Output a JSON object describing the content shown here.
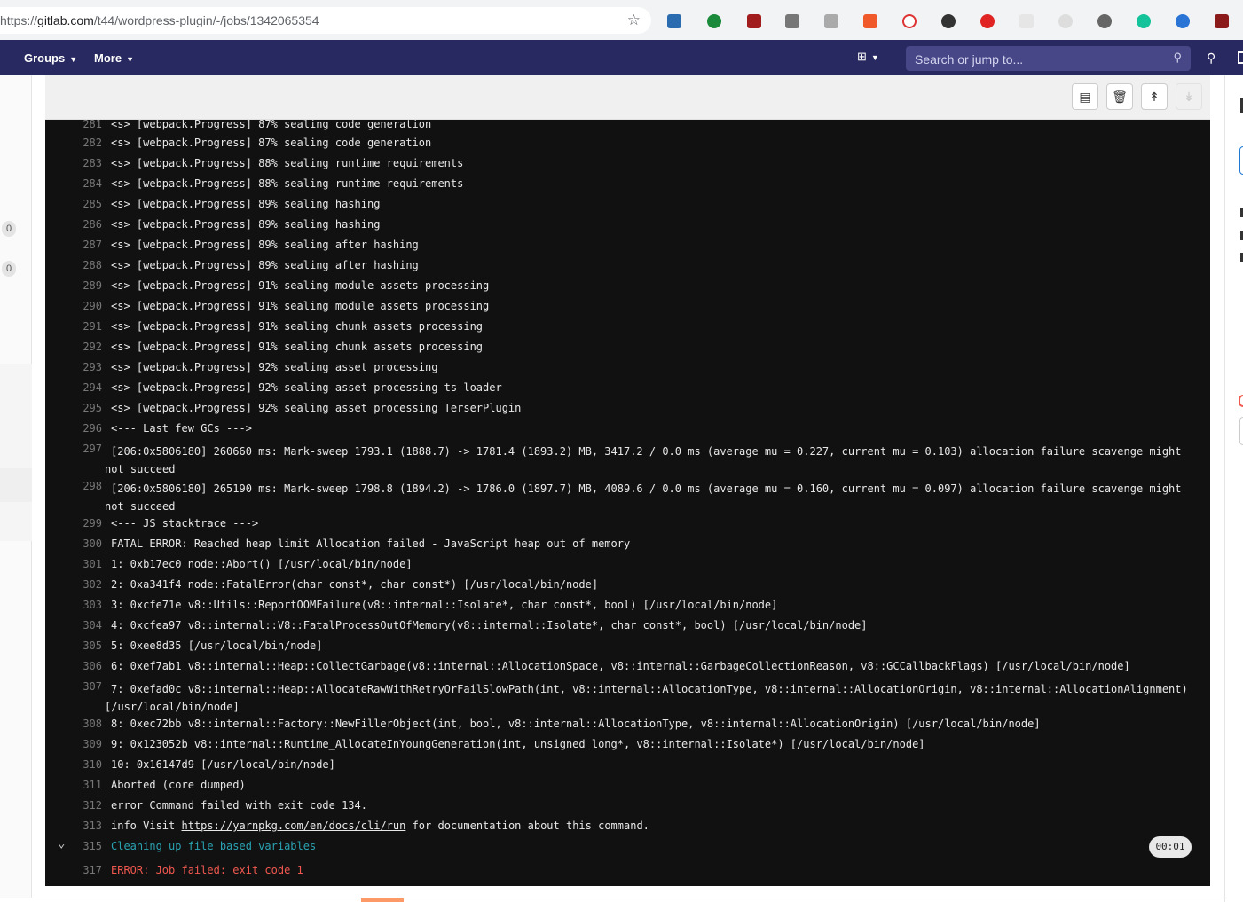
{
  "browser": {
    "url_prefix": "https://",
    "url_host": "gitlab.com",
    "url_path": "/t44/wordpress-plugin/-/jobs/1342065354"
  },
  "nav": {
    "groups_label": "Groups",
    "more_label": "More",
    "search_placeholder": "Search or jump to..."
  },
  "sidebar": {
    "badge_1": "0",
    "badge_2": "0"
  },
  "log": {
    "lines": [
      {
        "n": "281",
        "t": "<s> [webpack.Progress] 87% sealing code generation"
      },
      {
        "n": "282",
        "t": "<s> [webpack.Progress] 87% sealing code generation"
      },
      {
        "n": "283",
        "t": "<s> [webpack.Progress] 88% sealing runtime requirements"
      },
      {
        "n": "284",
        "t": "<s> [webpack.Progress] 88% sealing runtime requirements"
      },
      {
        "n": "285",
        "t": "<s> [webpack.Progress] 89% sealing hashing"
      },
      {
        "n": "286",
        "t": "<s> [webpack.Progress] 89% sealing hashing"
      },
      {
        "n": "287",
        "t": "<s> [webpack.Progress] 89% sealing after hashing"
      },
      {
        "n": "288",
        "t": "<s> [webpack.Progress] 89% sealing after hashing"
      },
      {
        "n": "289",
        "t": "<s> [webpack.Progress] 91% sealing module assets processing"
      },
      {
        "n": "290",
        "t": "<s> [webpack.Progress] 91% sealing module assets processing"
      },
      {
        "n": "291",
        "t": "<s> [webpack.Progress] 91% sealing chunk assets processing"
      },
      {
        "n": "292",
        "t": "<s> [webpack.Progress] 91% sealing chunk assets processing"
      },
      {
        "n": "293",
        "t": "<s> [webpack.Progress] 92% sealing asset processing"
      },
      {
        "n": "294",
        "t": "<s> [webpack.Progress] 92% sealing asset processing ts-loader"
      },
      {
        "n": "295",
        "t": "<s> [webpack.Progress] 92% sealing asset processing TerserPlugin"
      },
      {
        "n": "296",
        "t": "<--- Last few GCs --->"
      },
      {
        "n": "297",
        "t": "[206:0x5806180]   260660 ms: Mark-sweep 1793.1 (1888.7) -> 1781.4 (1893.2) MB, 3417.2 / 0.0 ms  (average mu = 0.227, current mu = 0.103) allocation failure scavenge might not succeed"
      },
      {
        "n": "298",
        "t": "[206:0x5806180]   265190 ms: Mark-sweep 1798.8 (1894.2) -> 1786.0 (1897.7) MB, 4089.6 / 0.0 ms  (average mu = 0.160, current mu = 0.097) allocation failure scavenge might not succeed"
      },
      {
        "n": "299",
        "t": "<--- JS stacktrace --->"
      },
      {
        "n": "300",
        "t": "FATAL ERROR: Reached heap limit Allocation failed - JavaScript heap out of memory"
      },
      {
        "n": "301",
        "t": " 1: 0xb17ec0 node::Abort() [/usr/local/bin/node]"
      },
      {
        "n": "302",
        "t": " 2: 0xa341f4 node::FatalError(char const*, char const*) [/usr/local/bin/node]"
      },
      {
        "n": "303",
        "t": " 3: 0xcfe71e v8::Utils::ReportOOMFailure(v8::internal::Isolate*, char const*, bool) [/usr/local/bin/node]"
      },
      {
        "n": "304",
        "t": " 4: 0xcfea97 v8::internal::V8::FatalProcessOutOfMemory(v8::internal::Isolate*, char const*, bool) [/usr/local/bin/node]"
      },
      {
        "n": "305",
        "t": " 5: 0xee8d35  [/usr/local/bin/node]"
      },
      {
        "n": "306",
        "t": " 6: 0xef7ab1 v8::internal::Heap::CollectGarbage(v8::internal::AllocationSpace, v8::internal::GarbageCollectionReason, v8::GCCallbackFlags) [/usr/local/bin/node]"
      },
      {
        "n": "307",
        "t": " 7: 0xefad0c v8::internal::Heap::AllocateRawWithRetryOrFailSlowPath(int, v8::internal::AllocationType, v8::internal::AllocationOrigin, v8::internal::AllocationAlignment) [/usr/local/bin/node]"
      },
      {
        "n": "308",
        "t": " 8: 0xec72bb v8::internal::Factory::NewFillerObject(int, bool, v8::internal::AllocationType, v8::internal::AllocationOrigin) [/usr/local/bin/node]"
      },
      {
        "n": "309",
        "t": " 9: 0x123052b v8::internal::Runtime_AllocateInYoungGeneration(int, unsigned long*, v8::internal::Isolate*) [/usr/local/bin/node]"
      },
      {
        "n": "310",
        "t": "10: 0x16147d9  [/usr/local/bin/node]"
      },
      {
        "n": "311",
        "t": "Aborted (core dumped)"
      },
      {
        "n": "312",
        "t": "error Command failed with exit code 134."
      }
    ],
    "info_line": {
      "n": "313",
      "prefix": "info Visit ",
      "link": "https://yarnpkg.com/en/docs/cli/run",
      "suffix": " for documentation about this command."
    },
    "section_line": {
      "n": "315",
      "t": "Cleaning up file based variables",
      "duration": "00:01"
    },
    "error_line": {
      "n": "317",
      "t": "ERROR: Job failed: exit code 1"
    }
  }
}
